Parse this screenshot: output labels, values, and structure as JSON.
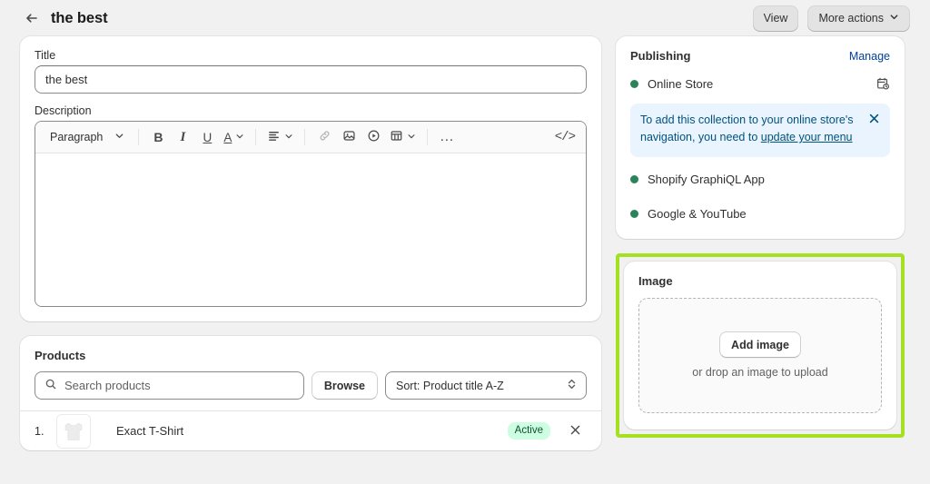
{
  "topbar": {
    "back_icon": "arrow-left-icon",
    "title": "the best",
    "view_label": "View",
    "more_actions_label": "More actions",
    "more_actions_chevron": "chevron-down-icon"
  },
  "title_card": {
    "title_label": "Title",
    "title_value": "the best",
    "description_label": "Description",
    "toolbar": {
      "block_format": "Paragraph",
      "block_chevron": "chevron-down-icon",
      "bold": "B",
      "italic": "I",
      "underline": "U",
      "text_color": "A",
      "text_color_chevron": "chevron-down-icon",
      "align": "align-left-icon",
      "align_chevron": "chevron-down-icon",
      "link": "link-icon",
      "image": "image-icon",
      "video": "video-play-icon",
      "table": "table-icon",
      "table_chevron": "chevron-down-icon",
      "more": "…",
      "code": "</>"
    },
    "description_value": ""
  },
  "products_card": {
    "heading": "Products",
    "search_placeholder": "Search products",
    "search_value": "",
    "search_icon": "search-icon",
    "browse_label": "Browse",
    "sort_label": "Sort: Product title A-Z",
    "sort_icon": "select-chevrons-icon",
    "rows": [
      {
        "index": "1.",
        "name": "Exact T-Shirt",
        "status": "Active",
        "thumb": "tshirt-thumbnail",
        "remove_icon": "close-icon"
      }
    ]
  },
  "publishing_card": {
    "heading": "Publishing",
    "manage_label": "Manage",
    "channels": [
      {
        "name": "Online Store",
        "status_color": "#29845a",
        "schedule_icon": "calendar-clock-icon"
      },
      {
        "name": "Shopify GraphiQL App",
        "status_color": "#29845a",
        "schedule_icon": ""
      },
      {
        "name": "Google & YouTube",
        "status_color": "#29845a",
        "schedule_icon": ""
      }
    ],
    "banner": {
      "text_before": "To add this collection to your online store's navigation, you need to ",
      "link_text": "update your menu",
      "dismiss_icon": "close-icon",
      "background": "#eaf4ff",
      "text_color": "#00527c"
    }
  },
  "image_card": {
    "heading": "Image",
    "add_image_label": "Add image",
    "drop_hint": "or drop an image to upload",
    "highlight_color": "#a6e022"
  }
}
